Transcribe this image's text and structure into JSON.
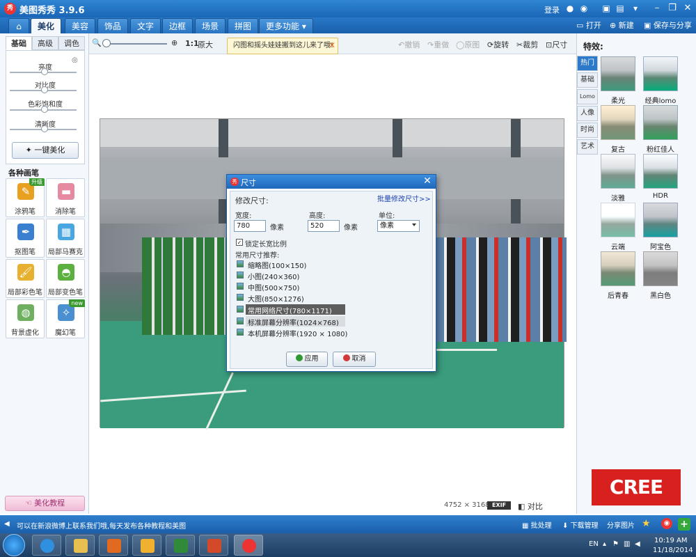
{
  "titlebar": {
    "app_logo_text": "秀",
    "title": "美图秀秀 3.9.6",
    "login": "登录"
  },
  "tabs": [
    {
      "label": "美化",
      "active": true
    },
    {
      "label": "美容"
    },
    {
      "label": "饰品"
    },
    {
      "label": "文字"
    },
    {
      "label": "边框"
    },
    {
      "label": "场景"
    },
    {
      "label": "拼图"
    },
    {
      "label": "更多功能"
    }
  ],
  "top_right": {
    "open": "打开",
    "new": "新建",
    "save": "保存与分享"
  },
  "toolbar": {
    "zoom_ratio": "1:1",
    "original_size": "原大",
    "tip": "闪图和摇头娃娃搬到这儿来了哦!",
    "undo": "撤销",
    "redo": "重做",
    "original": "原图",
    "rotate": "旋转",
    "crop": "裁剪",
    "resize": "尺寸"
  },
  "left": {
    "subtabs": [
      "基础",
      "高级",
      "调色"
    ],
    "adjustments": [
      "亮度",
      "对比度",
      "色彩饱和度",
      "清晰度"
    ],
    "one_click": "一键美化",
    "brush_heading": "各种画笔",
    "brushes": [
      {
        "label": "涂鸦笔",
        "badge": "升级"
      },
      {
        "label": "消除笔"
      },
      {
        "label": "抠图笔"
      },
      {
        "label": "局部马赛克"
      },
      {
        "label": "局部彩色笔"
      },
      {
        "label": "局部变色笔"
      },
      {
        "label": "背景虚化"
      },
      {
        "label": "魔幻笔",
        "badge": "new"
      }
    ],
    "tutorial": "美化教程"
  },
  "canvas": {
    "image_size": "4752 × 3168",
    "exif": "EXIF",
    "compare": "对比"
  },
  "dialog": {
    "logo_text": "秀",
    "title": "尺寸",
    "heading": "修改尺寸:",
    "batch_link": "批量修改尺寸>>",
    "width_label": "宽度:",
    "width_value": "780",
    "height_label": "高度:",
    "height_value": "520",
    "unit_px": "像素",
    "unit_label": "单位:",
    "unit_value": "像素",
    "lock_ratio": "锁定长宽比例",
    "presets_heading": "常用尺寸推荐:",
    "presets": [
      "缩略图(100×150)",
      "小图(240×360)",
      "中图(500×750)",
      "大图(850×1276)",
      "常用网络尺寸(780×1171)",
      "标准屏幕分辨率(1024×768)",
      "本机屏幕分辨率(1920 × 1080)"
    ],
    "apply": "应用",
    "cancel": "取消"
  },
  "right": {
    "fx_title": "特效:",
    "categories": [
      "热门",
      "基础",
      "Lomo",
      "人像",
      "时尚",
      "艺术"
    ],
    "effects": [
      "柔光",
      "经典lomo",
      "复古",
      "粉红佳人",
      "淡雅",
      "HDR",
      "云端",
      "阿宝色",
      "后青春",
      "黑白色"
    ],
    "cree": "CREE"
  },
  "statusbar": {
    "message": "可以在新浪微博上联系我们哦,每天发布各种教程和美图",
    "batch": "批处理",
    "download": "下载管理",
    "share": "分享图片"
  },
  "taskbar": {
    "lang": "EN",
    "time": "10:19 AM",
    "date": "11/18/2014"
  }
}
